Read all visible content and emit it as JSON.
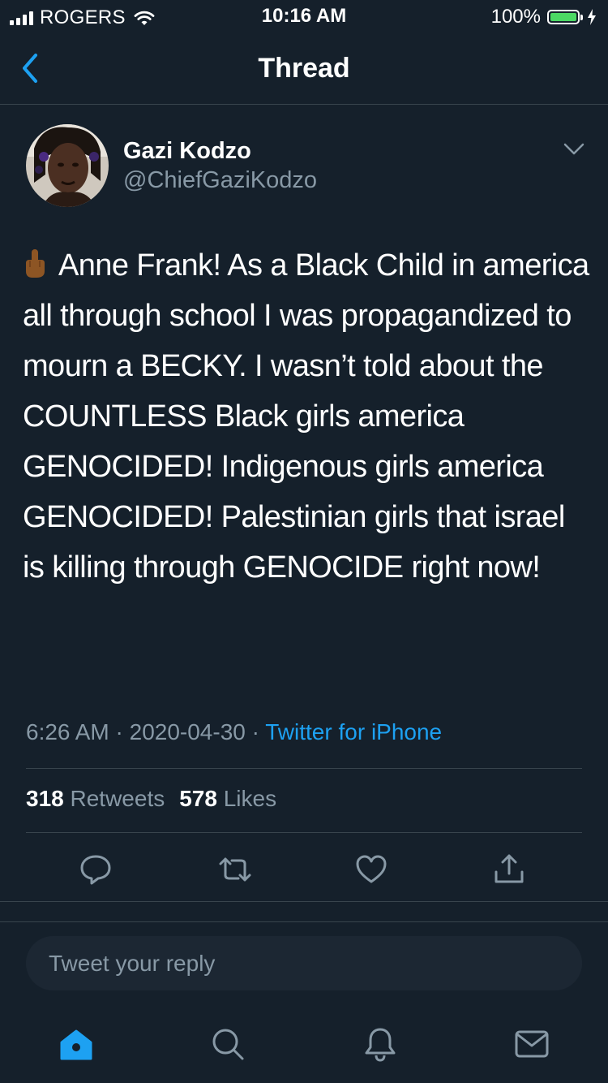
{
  "status_bar": {
    "carrier": "ROGERS",
    "time": "10:16 AM",
    "battery": "100%",
    "battery_level": 1.0,
    "battery_color": "#4cd964"
  },
  "nav": {
    "title": "Thread",
    "back_icon": "chevron-left-icon"
  },
  "tweet": {
    "display_name": "Gazi Kodzo",
    "handle": "@ChiefGaziKodzo",
    "emoji": "🖕🏾",
    "text": "Anne Frank! As a Black Child in america all through school I was propagandized to mourn a BECKY. I wasn’t told about the COUNTLESS Black girls america GENOCIDED! Indigenous girls america GENOCIDED! Palestinian girls that israel is killing through GENOCIDE right now!",
    "time": "6:26 AM",
    "date": "2020-04-30",
    "separator": "·",
    "source": "Twitter for iPhone",
    "retweets_count": "318",
    "retweets_label": "Retweets",
    "likes_count": "578",
    "likes_label": "Likes"
  },
  "actions": [
    "reply-icon",
    "retweet-icon",
    "like-icon",
    "share-icon"
  ],
  "reply_box": {
    "placeholder": "Tweet your reply"
  },
  "tab_bar": [
    "home-icon",
    "search-icon",
    "notifications-icon",
    "messages-icon"
  ],
  "colors": {
    "background": "#15202b",
    "accent": "#1da1f2",
    "secondary_text": "#8899a6",
    "divider": "#38444d"
  }
}
